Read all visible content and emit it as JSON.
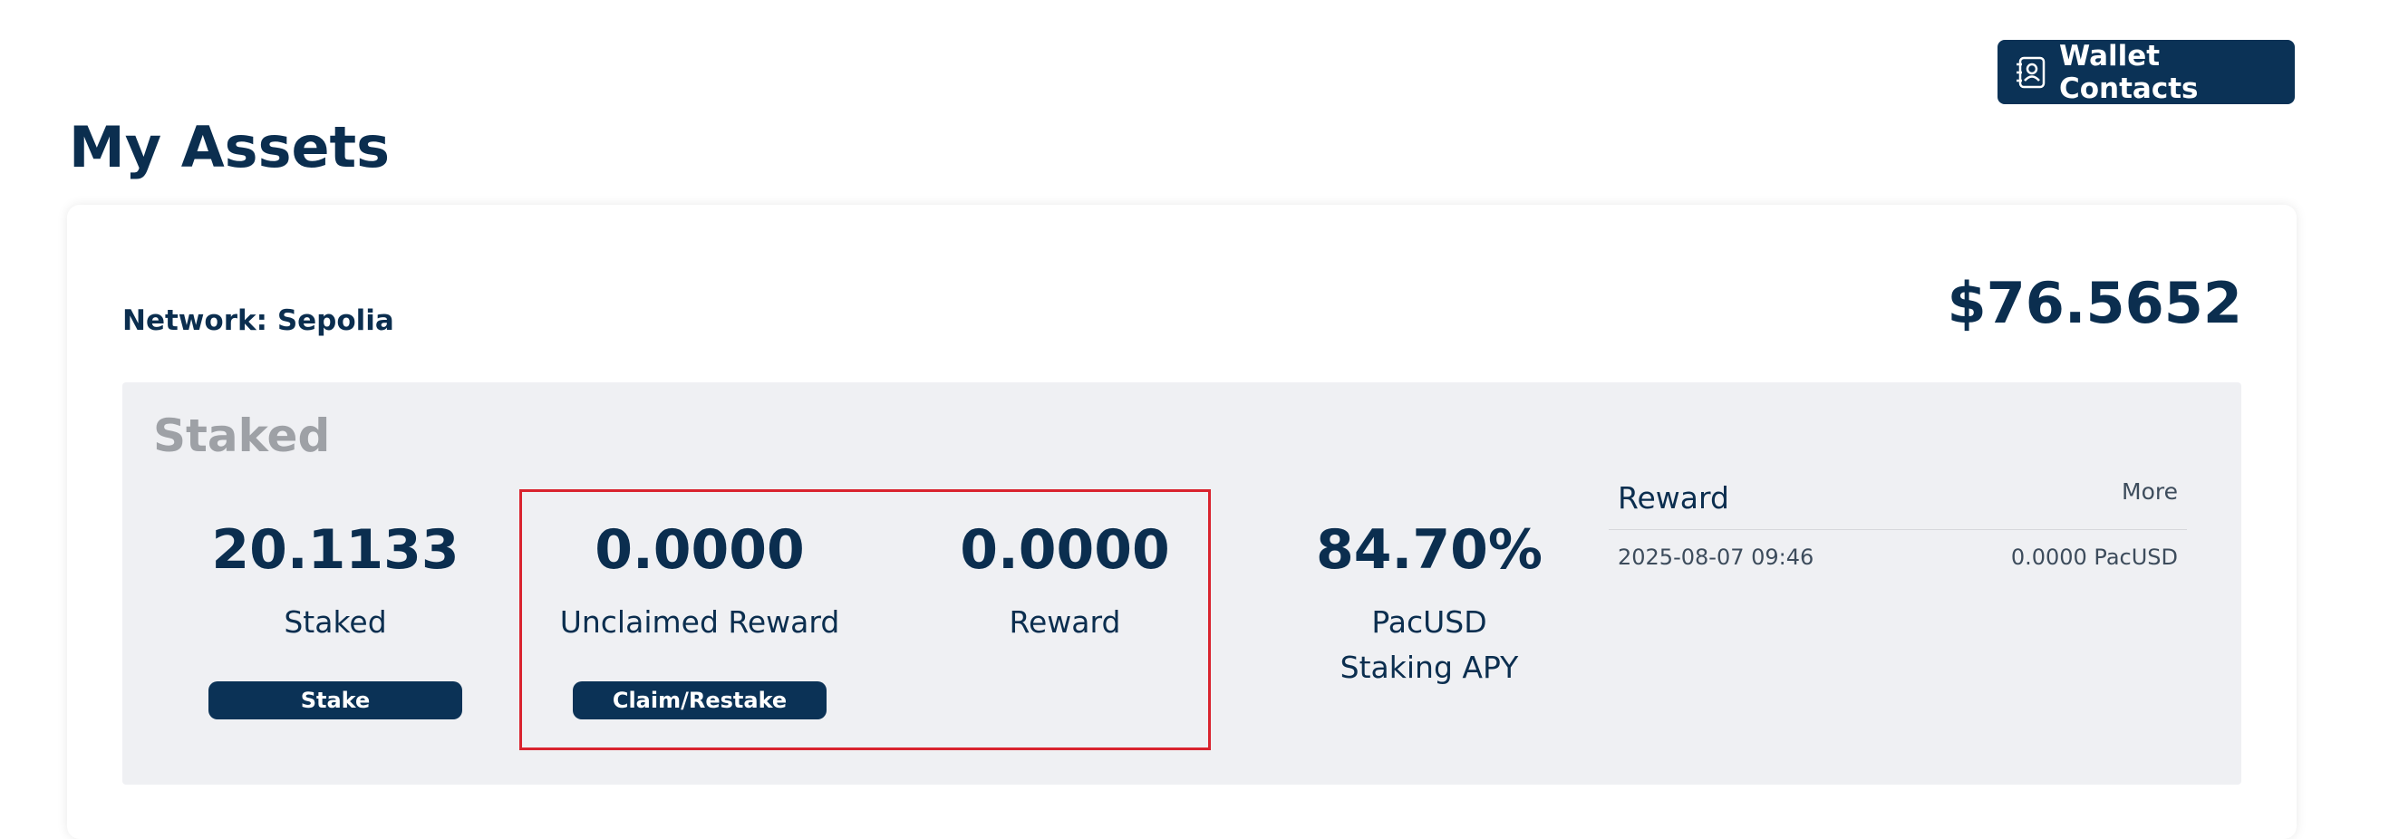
{
  "header": {
    "wallet_contacts_label": "Wallet Contacts",
    "page_title": "My Assets"
  },
  "assets": {
    "network_label": "Network: Sepolia",
    "total_value": "$76.5652"
  },
  "staked": {
    "title": "Staked",
    "stats": {
      "staked": {
        "value": "20.1133",
        "label": "Staked",
        "button": "Stake"
      },
      "unclaimed": {
        "value": "0.0000",
        "label": "Unclaimed Reward",
        "button": "Claim/Restake"
      },
      "reward": {
        "value": "0.0000",
        "label": "Reward"
      },
      "apy": {
        "value": "84.70%",
        "label": "PacUSD Staking APY"
      }
    }
  },
  "reward_history": {
    "title": "Reward",
    "more_label": "More",
    "rows": [
      {
        "date": "2025-08-07 09:46",
        "amount": "0.0000 PacUSD"
      }
    ]
  },
  "colors": {
    "primary": "#0b3256",
    "text": "#0b2e4f",
    "panel_bg": "#eff0f3",
    "highlight": "#d9232e",
    "muted_title": "#9ea1a6"
  },
  "icons": {
    "wallet_contacts": "contact-book-icon"
  }
}
